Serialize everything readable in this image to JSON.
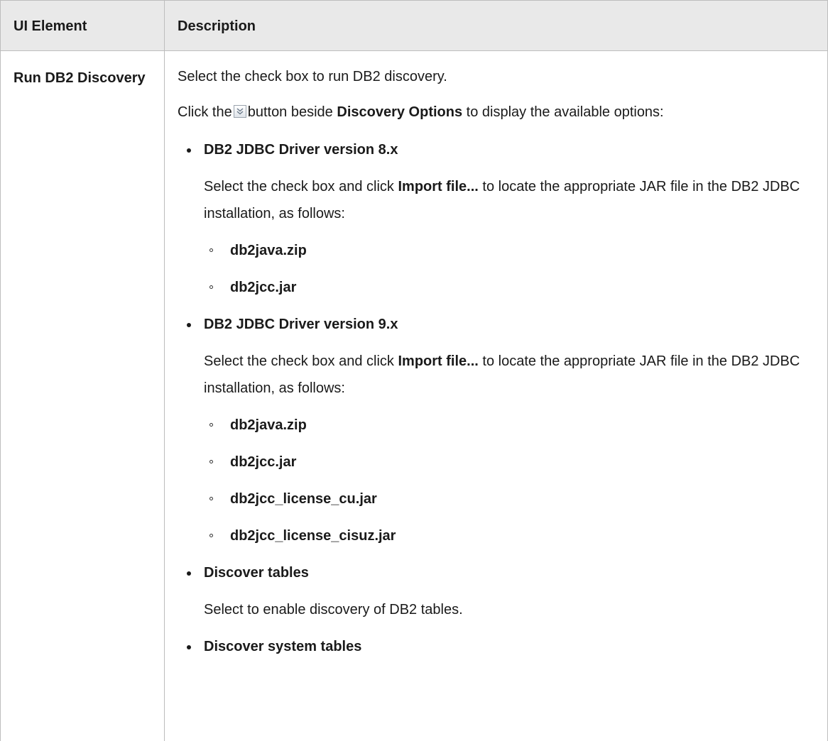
{
  "table": {
    "headers": [
      "UI Element",
      "Description"
    ],
    "row": {
      "element": "Run DB2 Discovery",
      "intro": "Select the check box to run DB2 discovery.",
      "click_prefix": "Click the",
      "click_mid": "button beside",
      "click_bold": "Discovery Options",
      "click_suffix": "to display the available options:",
      "expand_icon": "double-chevron-down-icon",
      "options": [
        {
          "title": "DB2 JDBC Driver version 8.x",
          "desc_prefix": "Select the check box and click",
          "desc_bold": "Import file...",
          "desc_suffix": "to locate the appropriate JAR file in the DB2 JDBC installation, as follows:",
          "files": [
            "db2java.zip",
            "db2jcc.jar"
          ]
        },
        {
          "title": "DB2 JDBC Driver version 9.x",
          "desc_prefix": "Select the check box and click",
          "desc_bold": "Import file...",
          "desc_suffix": "to locate the appropriate JAR file in the DB2 JDBC installation, as follows:",
          "files": [
            "db2java.zip",
            "db2jcc.jar",
            "db2jcc_license_cu.jar",
            "db2jcc_license_cisuz.jar"
          ]
        },
        {
          "title": "Discover tables",
          "desc": "Select to enable discovery of DB2 tables."
        },
        {
          "title": "Discover system tables"
        }
      ]
    }
  }
}
